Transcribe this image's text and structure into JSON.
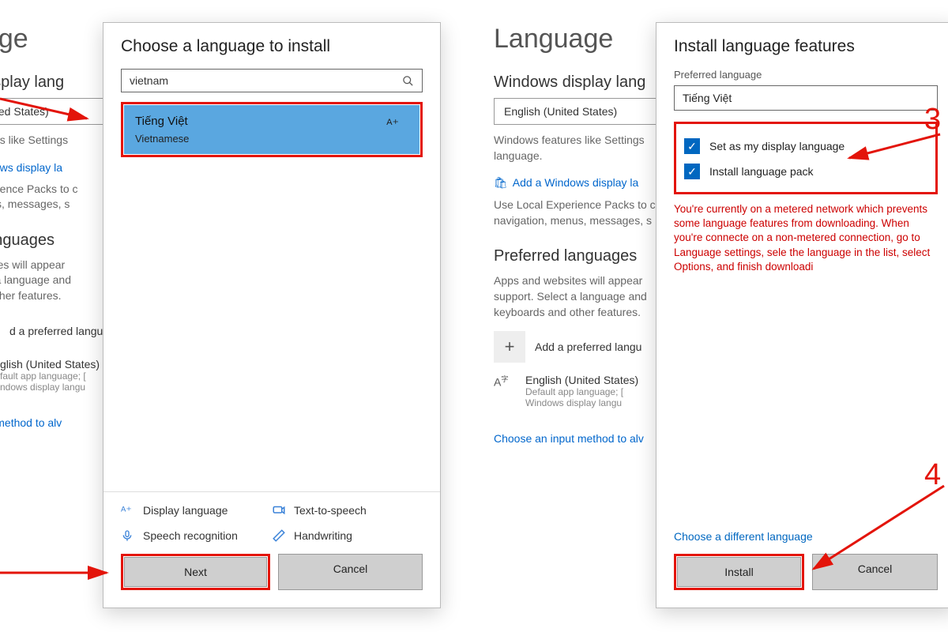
{
  "bg_left": {
    "heading": "uage",
    "section1": "s display lang",
    "dropdown": "United States)",
    "desc1": "eatures like Settings",
    "link1": "Windows display la",
    "desc2": "Experience Packs to c\nmenus, messages, s",
    "section2": "d languages",
    "desc3": "vebsites will appear\nelect a language and\nand other features.",
    "add": "d a preferred langu",
    "lang": "glish (United States)",
    "sub1": "fault app language; [",
    "sub2": "ndows display langu",
    "link2": "input method to alv"
  },
  "bg_right": {
    "heading": "Language",
    "section1": "Windows display lang",
    "dropdown": "English (United States)",
    "desc1": "Windows features like Settings\nlanguage.",
    "link1": "Add a Windows display la",
    "desc2": "Use Local Experience Packs to c\nnavigation, menus, messages, s",
    "section2": "Preferred languages",
    "desc3": "Apps and websites will appear\nsupport. Select a language and\nkeyboards and other features.",
    "add": "Add a preferred langu",
    "lang": "English (United States)",
    "sub1": "Default app language; [",
    "sub2": "Windows display langu",
    "link2": "Choose an input method to alv"
  },
  "panel_left": {
    "title": "Choose a language to install",
    "search_value": "vietnam",
    "result_native": "Tiếng Việt",
    "result_eng": "Vietnamese",
    "legend": {
      "display": "Display language",
      "tts": "Text-to-speech",
      "speech": "Speech recognition",
      "hand": "Handwriting"
    },
    "next": "Next",
    "cancel": "Cancel"
  },
  "panel_right": {
    "title": "Install language features",
    "sub_label": "Preferred language",
    "lang_value": "Tiếng Việt",
    "check1": "Set as my display language",
    "check2": "Install language pack",
    "warning": "You're currently on a metered network which prevents some language features from downloading. When you're connecte on a non-metered connection, go to Language settings, sele the language in the list, select Options, and finish downloadi",
    "alt_link": "Choose a different language",
    "install": "Install",
    "cancel": "Cancel"
  },
  "annotations": {
    "num3": "3",
    "num4": "4"
  }
}
